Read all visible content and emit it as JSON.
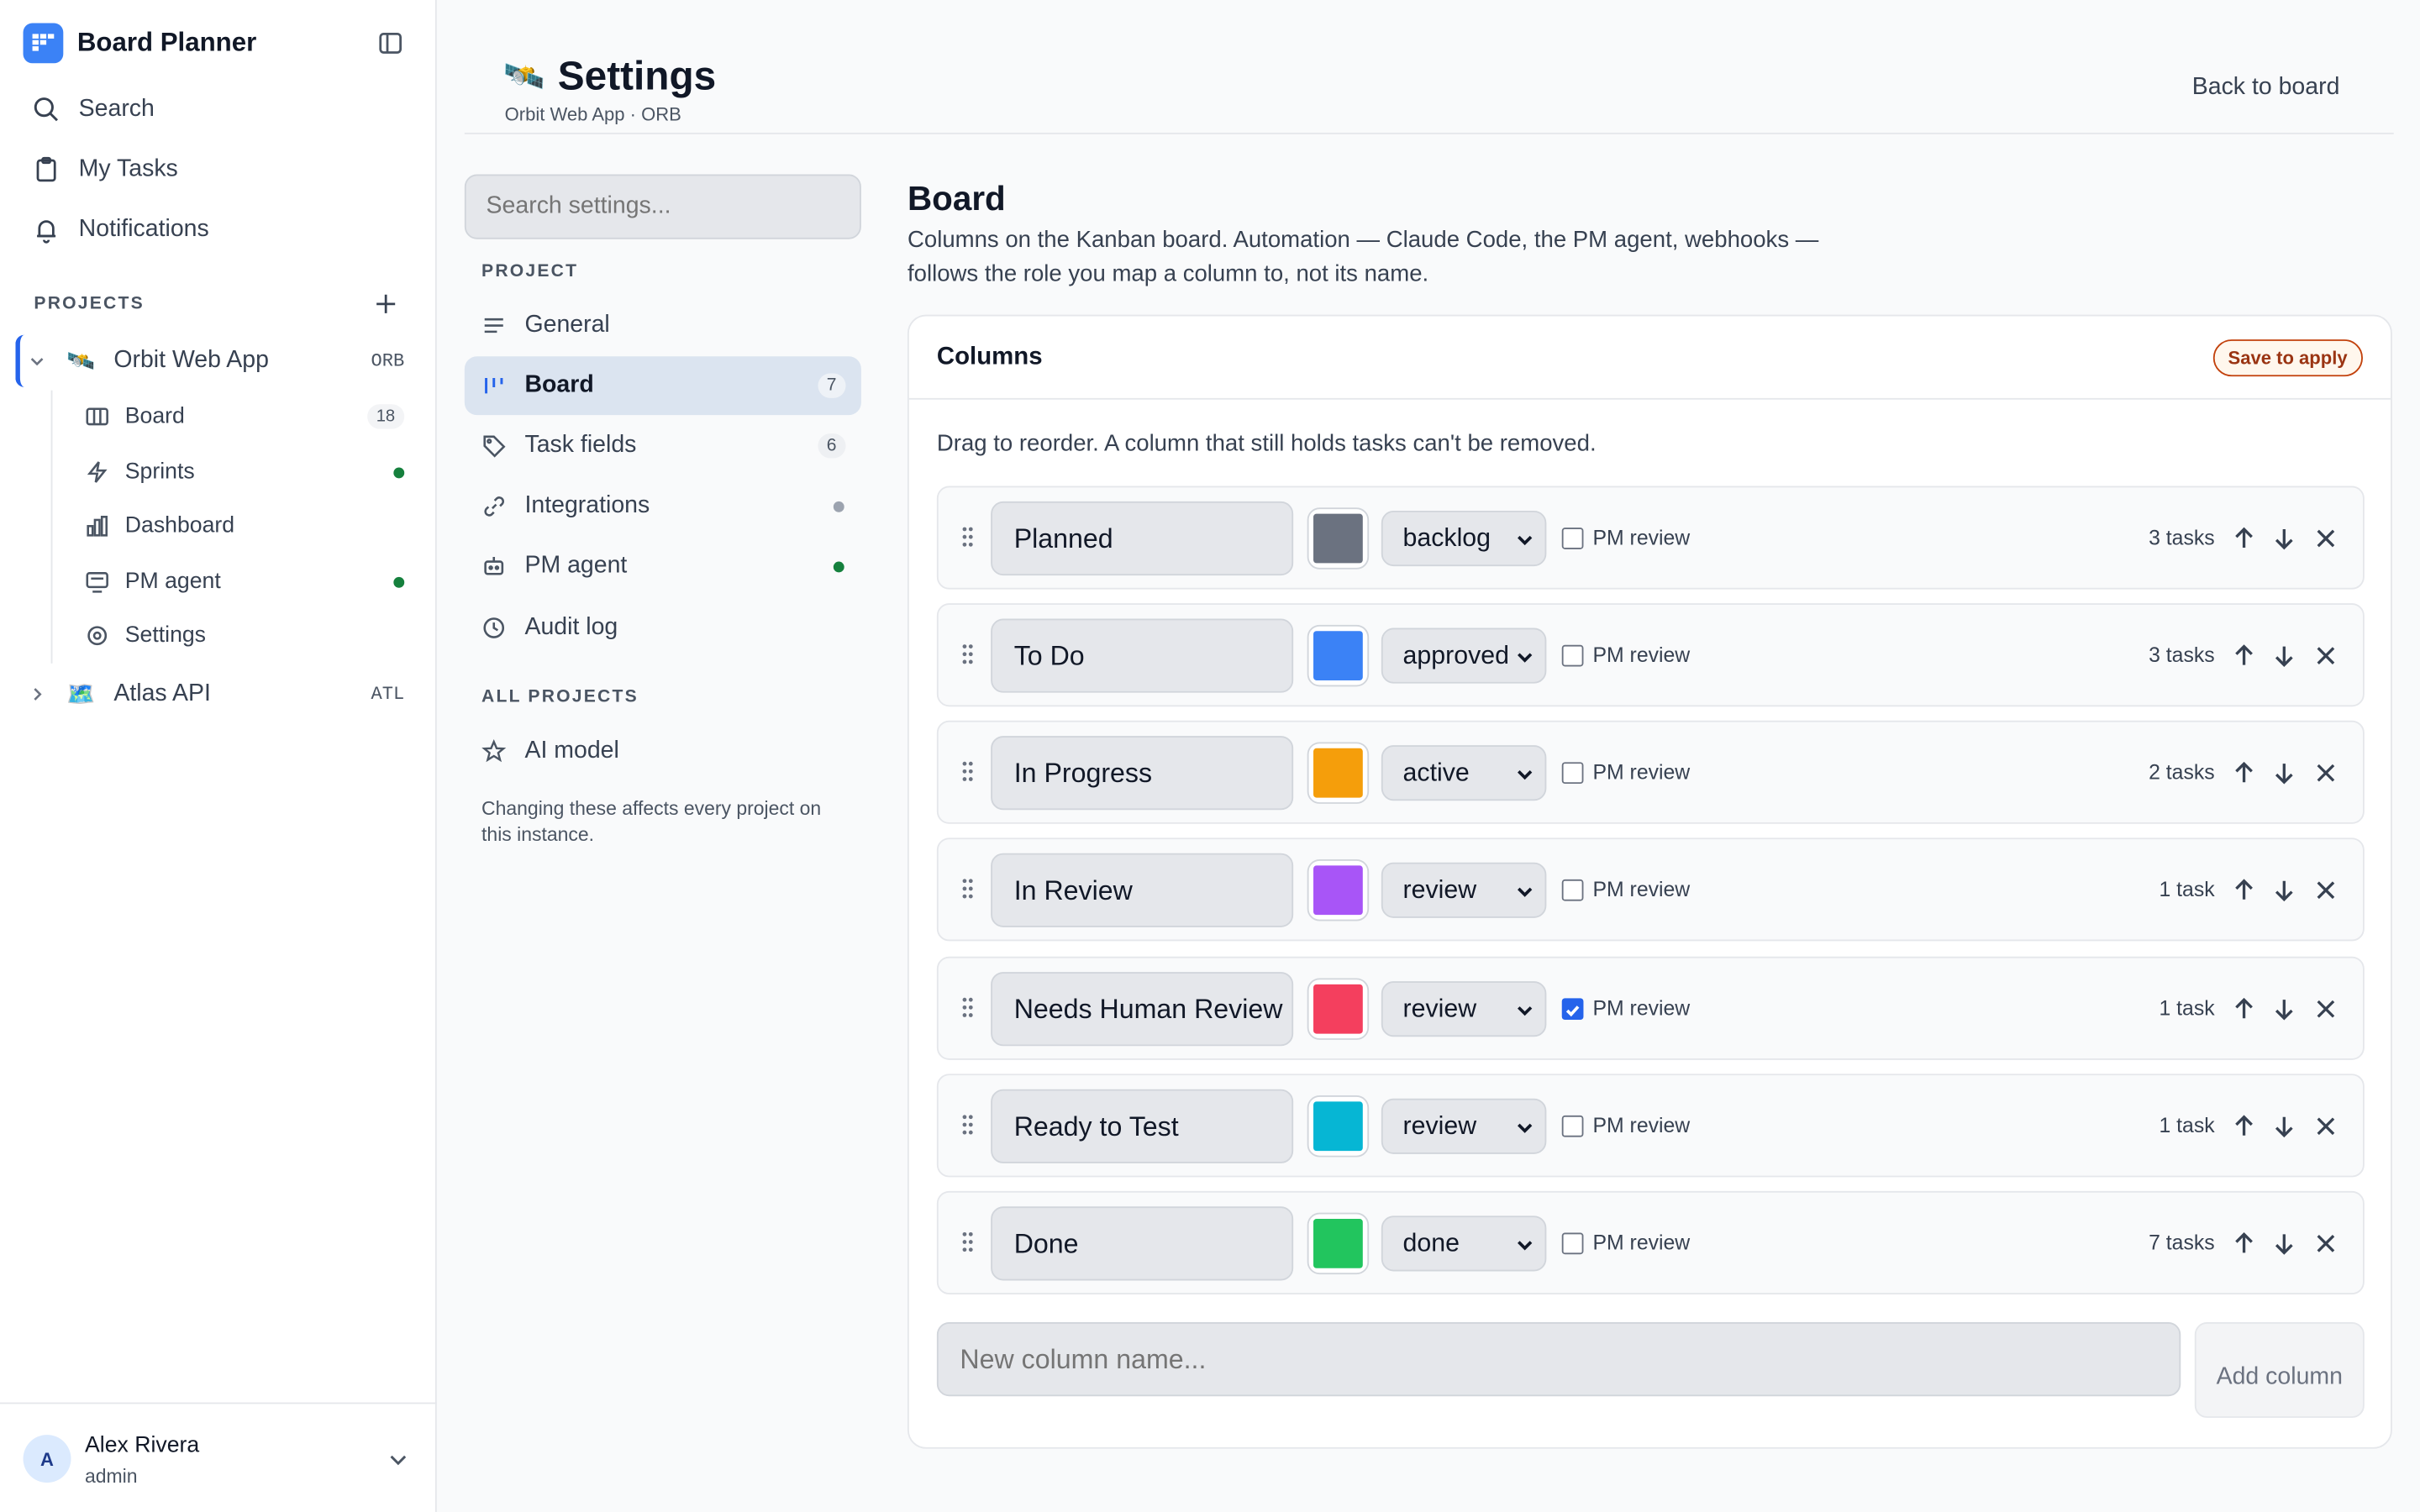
{
  "app": {
    "title": "Board Planner"
  },
  "nav": {
    "search": "Search",
    "my_tasks": "My Tasks",
    "notifications": "Notifications"
  },
  "projects": {
    "heading": "PROJECTS",
    "items": [
      {
        "name": "Orbit Web App",
        "code": "ORB",
        "emoji": "🛰️"
      },
      {
        "name": "Atlas API",
        "code": "ATL",
        "emoji": "🗺️"
      }
    ],
    "orbit_children": [
      {
        "label": "Board",
        "count": "18"
      },
      {
        "label": "Sprints",
        "dot_color": "#15803d"
      },
      {
        "label": "Dashboard"
      },
      {
        "label": "PM agent",
        "dot_color": "#15803d"
      },
      {
        "label": "Settings"
      }
    ]
  },
  "user": {
    "initial": "A",
    "name": "Alex Rivera",
    "role": "admin"
  },
  "header": {
    "emoji": "🛰️",
    "title": "Settings",
    "subtitle": "Orbit Web App · ORB",
    "back": "Back to board"
  },
  "settings_nav": {
    "search_placeholder": "Search settings...",
    "project_heading": "PROJECT",
    "items": [
      {
        "label": "General"
      },
      {
        "label": "Board",
        "count": "7"
      },
      {
        "label": "Task fields",
        "count": "6"
      },
      {
        "label": "Integrations",
        "dot_color": "#9ca3af"
      },
      {
        "label": "PM agent",
        "dot_color": "#15803d"
      },
      {
        "label": "Audit log"
      }
    ],
    "all_heading": "ALL PROJECTS",
    "all_items": [
      {
        "label": "AI model"
      }
    ],
    "note": "Changing these affects every project on this instance."
  },
  "board": {
    "title": "Board",
    "description": "Columns on the Kanban board. Automation — Claude Code, the PM agent, webhooks — follows the role you map a column to, not its name.",
    "card_title": "Columns",
    "save_badge": "Save to apply",
    "hint": "Drag to reorder. A column that still holds tasks can't be removed.",
    "pm_review_label": "PM review",
    "columns": [
      {
        "name": "Planned",
        "color": "#6b7280",
        "role": "backlog",
        "pm_review": false,
        "tasks": "3 tasks"
      },
      {
        "name": "To Do",
        "color": "#3b82f6",
        "role": "approved",
        "pm_review": false,
        "tasks": "3 tasks"
      },
      {
        "name": "In Progress",
        "color": "#f59e0b",
        "role": "active",
        "pm_review": false,
        "tasks": "2 tasks"
      },
      {
        "name": "In Review",
        "color": "#a855f7",
        "role": "review",
        "pm_review": false,
        "tasks": "1 task"
      },
      {
        "name": "Needs Human Review",
        "color": "#f43f5e",
        "role": "review",
        "pm_review": true,
        "tasks": "1 task"
      },
      {
        "name": "Ready to Test",
        "color": "#06b6d4",
        "role": "review",
        "pm_review": false,
        "tasks": "1 task"
      },
      {
        "name": "Done",
        "color": "#22c55e",
        "role": "done",
        "pm_review": false,
        "tasks": "7 tasks"
      }
    ],
    "new_column_placeholder": "New column name...",
    "add_column": "Add column"
  }
}
